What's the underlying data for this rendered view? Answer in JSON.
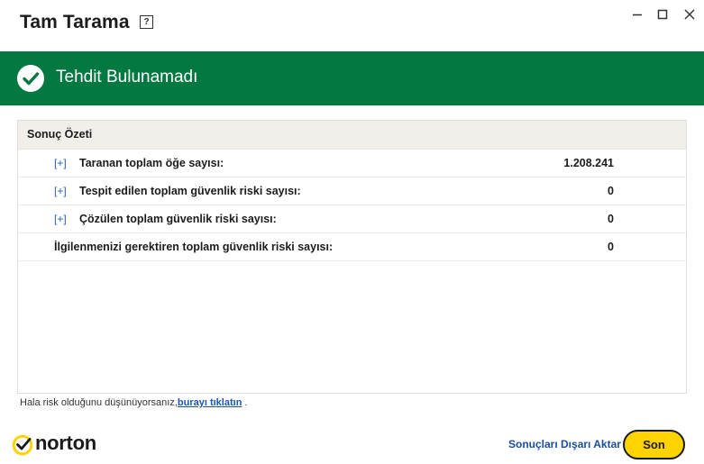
{
  "window": {
    "title": "Tam Tarama",
    "help_glyph": "?"
  },
  "banner": {
    "text": "Tehdit Bulunamadı",
    "color": "#037840"
  },
  "summary": {
    "header": "Sonuç Özeti",
    "rows": [
      {
        "expand": "[+]",
        "label": "Taranan toplam öğe sayısı:",
        "value": "1.208.241"
      },
      {
        "expand": "[+]",
        "label": "Tespit edilen toplam güvenlik riski sayısı:",
        "value": "0"
      },
      {
        "expand": "[+]",
        "label": "Çözülen toplam güvenlik riski sayısı:",
        "value": "0"
      },
      {
        "label": "İlgilenmenizi gerektiren toplam güvenlik riski sayısı:",
        "value": "0"
      }
    ]
  },
  "footnote": {
    "text": "Hala risk olduğunu düşünüyorsanız,",
    "link": "burayı tıklatın",
    "suffix": "."
  },
  "footer": {
    "logo_text": "norton",
    "export_label": "Sonuçları Dışarı Aktar",
    "close_label": "Son",
    "accent": "#fed300"
  }
}
